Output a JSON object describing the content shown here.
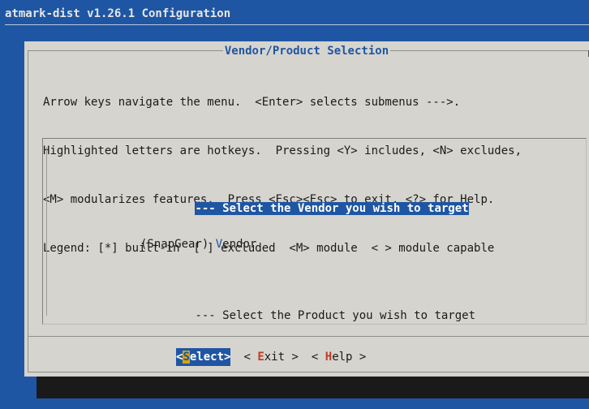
{
  "window": {
    "title": "atmark-dist v1.26.1 Configuration"
  },
  "dialog": {
    "title": "Vendor/Product Selection",
    "help_lines": [
      "Arrow keys navigate the menu.  <Enter> selects submenus --->.",
      "Highlighted letters are hotkeys.  Pressing <Y> includes, <N> excludes,",
      "<M> modularizes features.  Press <Esc><Esc> to exit, <?> for Help.",
      "Legend: [*] built-in  [ ] excluded  <M> module  < > module capable"
    ]
  },
  "menu": {
    "items": [
      {
        "text": "--- Select the Vendor you wish to target",
        "selected": true
      },
      {
        "prefix": "(SnapGear) ",
        "hotkey": "V",
        "rest": "endor",
        "selected": false
      },
      {
        "text": "--- Select the Product you wish to target",
        "selected": false
      }
    ]
  },
  "buttons": {
    "select": {
      "open": "<",
      "hotkey": "S",
      "rest": "elect>"
    },
    "exit": {
      "open": "< ",
      "hotkey": "E",
      "rest": "xit >"
    },
    "help": {
      "open": "< ",
      "hotkey": "H",
      "rest": "elp >"
    }
  },
  "colors": {
    "background": "#1f56a3",
    "dialog": "#d6d4ce",
    "highlight": "#1f56a3",
    "hotkey": "#c23b22",
    "cursor": "#d9a400"
  }
}
